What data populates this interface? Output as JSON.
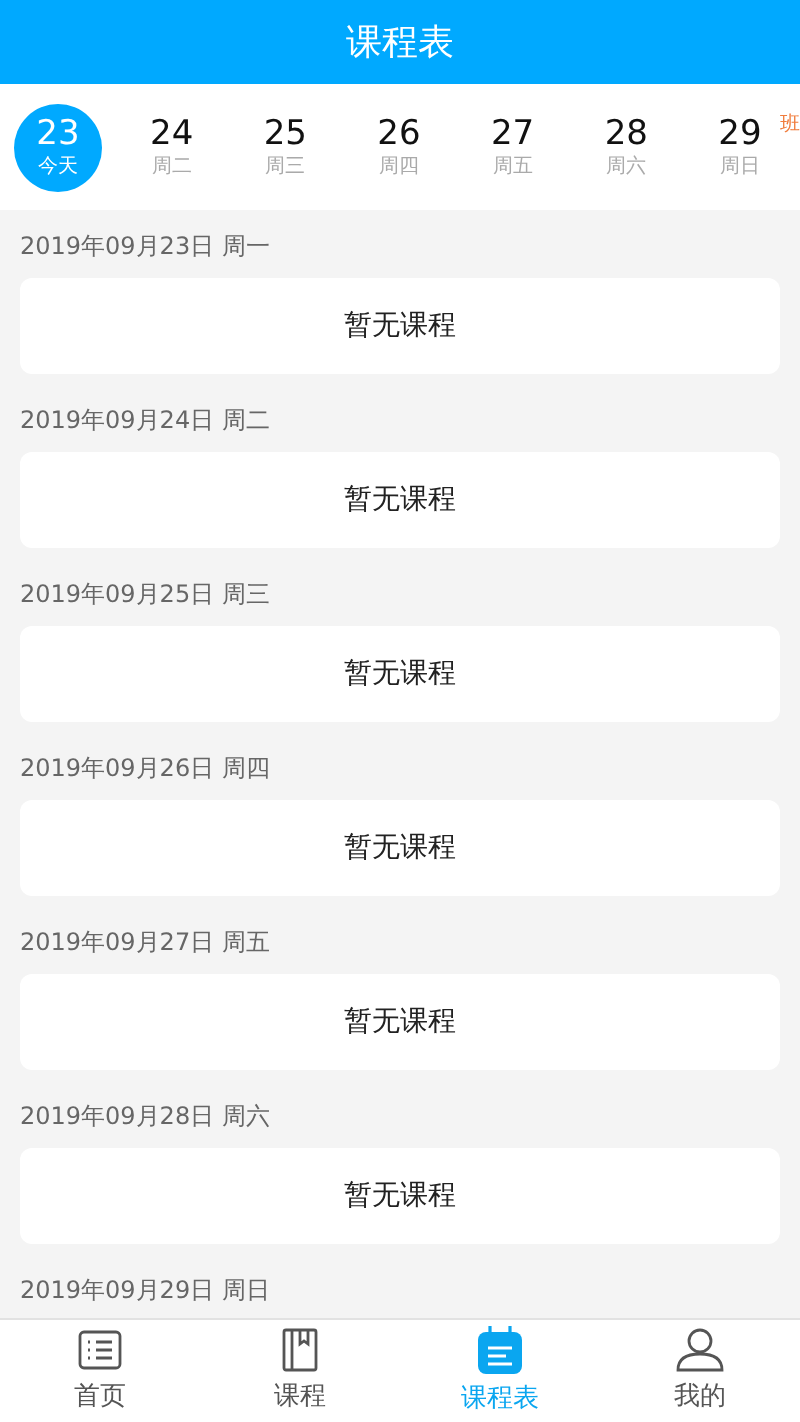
{
  "header": {
    "title": "课程表"
  },
  "days": [
    {
      "day": "23",
      "weekday": "今天",
      "selected": true
    },
    {
      "day": "24",
      "weekday": "周二",
      "selected": false
    },
    {
      "day": "25",
      "weekday": "周三",
      "selected": false
    },
    {
      "day": "26",
      "weekday": "周四",
      "selected": false
    },
    {
      "day": "27",
      "weekday": "周五",
      "selected": false
    },
    {
      "day": "28",
      "weekday": "周六",
      "selected": false
    },
    {
      "day": "29",
      "weekday": "周日",
      "selected": false,
      "badge": "班"
    }
  ],
  "schedule": [
    {
      "date": "2019年09月23日 周一",
      "message": "暂无课程"
    },
    {
      "date": "2019年09月24日 周二",
      "message": "暂无课程"
    },
    {
      "date": "2019年09月25日 周三",
      "message": "暂无课程"
    },
    {
      "date": "2019年09月26日 周四",
      "message": "暂无课程"
    },
    {
      "date": "2019年09月27日 周五",
      "message": "暂无课程"
    },
    {
      "date": "2019年09月28日 周六",
      "message": "暂无课程"
    },
    {
      "date": "2019年09月29日 周日"
    }
  ],
  "nav": [
    {
      "label": "首页",
      "kind": "list",
      "selected": false
    },
    {
      "label": "课程",
      "kind": "book",
      "selected": false
    },
    {
      "label": "课程表",
      "kind": "calendar",
      "selected": true
    },
    {
      "label": "我的",
      "kind": "person",
      "selected": false
    }
  ]
}
